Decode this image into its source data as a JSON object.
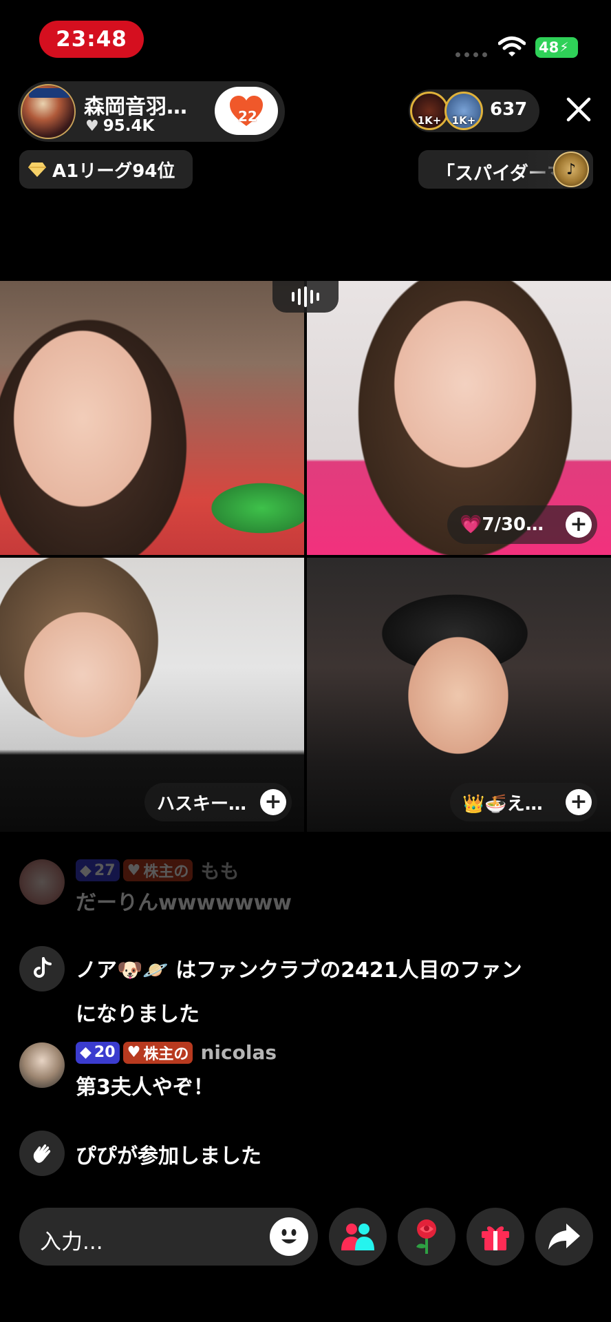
{
  "status_bar": {
    "time": "23:48",
    "battery": "48"
  },
  "host": {
    "name": "森岡音羽…",
    "likes": "95.4K",
    "fan_level": "22"
  },
  "viewers": {
    "rank1": "1K+",
    "rank2": "1K+",
    "count": "637"
  },
  "league": {
    "label": "A1リーグ94位"
  },
  "music": {
    "title": "「スパイダーマ"
  },
  "guests": [
    {
      "label": "💗7/30…"
    },
    {
      "label": "ハスキー…"
    },
    {
      "label": "👑🍜え…"
    }
  ],
  "chat": [
    {
      "diamond_level": "27",
      "shareholder": "株主の",
      "username": "もも",
      "text": "だーりんwwwwwww"
    },
    {
      "system_line1": "ノア🐶🪐 はファンクラブの2421人目のファン",
      "system_line2": "になりました"
    },
    {
      "diamond_level": "20",
      "shareholder": "株主の",
      "username": "nicolas",
      "text": "第3夫人やぞ！"
    },
    {
      "system_text": "ぴぴが参加しました"
    }
  ],
  "input": {
    "placeholder": "入力..."
  },
  "icons": [
    "wifi-icon",
    "heart-icon",
    "close-icon",
    "diamond-icon",
    "music-disc-icon",
    "plus-icon",
    "tiktok-icon",
    "wave-hand-icon",
    "smile-icon",
    "people-icon",
    "rose-icon",
    "gift-icon",
    "share-icon"
  ],
  "colors": {
    "time_pill": "#d50f1f",
    "battery": "#2fd158",
    "accent_pink": "#fe2c55",
    "diamond_badge": "#3b3ccf",
    "shareholder_badge": "#b83a1f"
  }
}
